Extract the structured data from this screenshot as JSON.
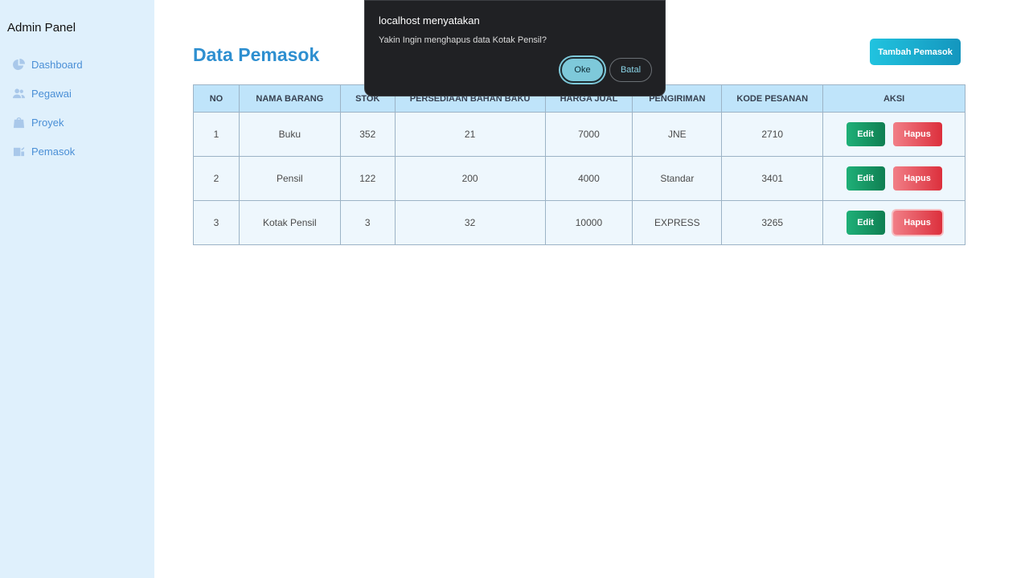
{
  "sidebar": {
    "title": "Admin Panel",
    "items": [
      {
        "label": "Dashboard",
        "icon": "chart-pie-icon"
      },
      {
        "label": "Pegawai",
        "icon": "users-icon"
      },
      {
        "label": "Proyek",
        "icon": "bag-icon"
      },
      {
        "label": "Pemasok",
        "icon": "supplier-icon"
      }
    ]
  },
  "main": {
    "title": "Data Pemasok",
    "add_button": "Tambah Pemasok",
    "table": {
      "headers": [
        "NO",
        "NAMA BARANG",
        "STOK",
        "PERSEDIAAN BAHAN BAKU",
        "HARGA JUAL",
        "PENGIRIMAN",
        "KODE PESANAN",
        "AKSI"
      ],
      "rows": [
        [
          "1",
          "Buku",
          "352",
          "21",
          "7000",
          "JNE",
          "2710"
        ],
        [
          "2",
          "Pensil",
          "122",
          "200",
          "4000",
          "Standar",
          "3401"
        ],
        [
          "3",
          "Kotak Pensil",
          "3",
          "32",
          "10000",
          "EXPRESS",
          "3265"
        ]
      ],
      "edit_label": "Edit",
      "delete_label": "Hapus"
    }
  },
  "dialog": {
    "title": "localhost menyatakan",
    "message": "Yakin Ingin menghapus data Kotak Pensil?",
    "ok_label": "Oke",
    "cancel_label": "Batal"
  },
  "colors": {
    "accent": "#2e8fd0",
    "sidebar_bg": "#dff0fc",
    "edit": "#1fb078",
    "delete": "#dc2f3c"
  }
}
